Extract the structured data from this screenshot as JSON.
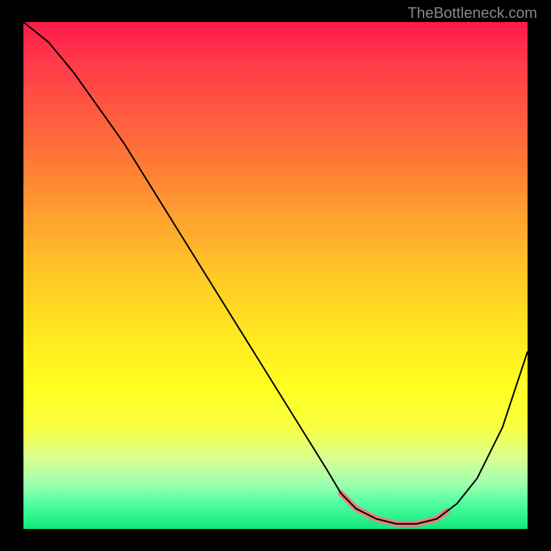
{
  "watermark": "TheBottleneck.com",
  "chart_data": {
    "type": "line",
    "title": "",
    "xlabel": "",
    "ylabel": "",
    "xlim": [
      0,
      100
    ],
    "ylim": [
      0,
      100
    ],
    "grid": false,
    "series": [
      {
        "name": "bottleneck-curve",
        "x": [
          0,
          5,
          10,
          15,
          20,
          25,
          30,
          35,
          40,
          45,
          50,
          55,
          60,
          63,
          66,
          70,
          74,
          78,
          82,
          86,
          90,
          95,
          100
        ],
        "values": [
          100,
          96,
          90,
          83,
          76,
          68,
          60,
          52,
          44,
          36,
          28,
          20,
          12,
          7,
          4,
          2,
          1,
          1,
          2,
          5,
          10,
          20,
          35
        ]
      }
    ],
    "highlight": {
      "name": "optimal-range",
      "x_start": 63,
      "x_end": 84,
      "note": "pink marker along trough"
    },
    "gradient_note": "background heat gradient: red (top/high bottleneck) → yellow → green (bottom/low bottleneck)"
  }
}
